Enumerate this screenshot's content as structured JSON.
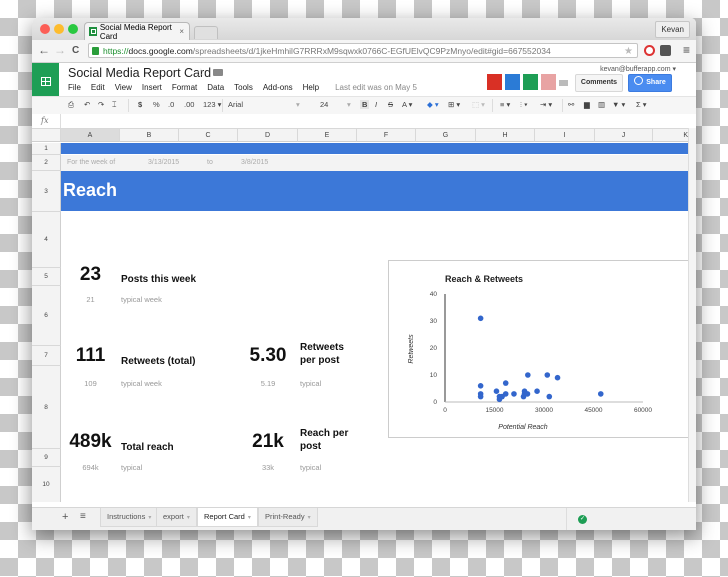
{
  "browser": {
    "tab_title": "Social Media Report Card",
    "tab_close": "×",
    "user_button": "Kevan",
    "url_scheme": "https://",
    "url_host": "docs.google.com",
    "url_path": "/spreadsheets/d/1jkeHmhilG7RRRxM9sqwxk0766C-EGfUElvQC9PzMnyo/edit#gid=667552034",
    "nav_back": "←",
    "nav_forward": "→",
    "nav_reload": "C",
    "bookmark_star": "★",
    "menu_icon": "≡"
  },
  "app": {
    "doc_title": "Social Media Report Card",
    "star": "☆",
    "account": "kevan@bufferapp.com ▾",
    "menu": [
      "File",
      "Edit",
      "View",
      "Insert",
      "Format",
      "Data",
      "Tools",
      "Add-ons",
      "Help"
    ],
    "last_edit": "Last edit was on May 5",
    "comments_label": "Comments",
    "share_label": "Share",
    "addon_colors": [
      "#d93025",
      "#2b7bd6",
      "#1e9e55",
      "#e8a3a3"
    ]
  },
  "toolbar": {
    "print": "⎙",
    "undo": "↶",
    "redo": "↷",
    "paint": "⌶",
    "currency": "$",
    "percent": "%",
    "dec_less": ".0",
    "dec_more": ".00",
    "more_formats": "123 ▾",
    "font": "Arial",
    "font_caret": "▾",
    "size": "24",
    "size_caret": "▾",
    "bold": "B",
    "italic": "I",
    "strike": "S",
    "text_color": "A ▾",
    "fill": "◆ ▾",
    "borders": "⊞ ▾",
    "merge": "⬚ ▾",
    "align": "≡ ▾",
    "valign": "⫶ ▾",
    "wrap": "⇥ ▾",
    "link": "⚯",
    "comment": "▆",
    "chart": "▥",
    "filter": "▼ ▾",
    "functions": "Σ ▾"
  },
  "formula_bar": {
    "fx": "fx",
    "value": ""
  },
  "sheet": {
    "columns": [
      "A",
      "B",
      "C",
      "D",
      "E",
      "F",
      "G",
      "H",
      "I",
      "J",
      "K"
    ],
    "rows": [
      "1",
      "2",
      "3",
      "4",
      "5",
      "6",
      "7",
      "8",
      "9",
      "10"
    ],
    "row2": {
      "label": "For the week of",
      "start": "3/13/2015",
      "to": "to",
      "end": "3/8/2015"
    },
    "section_title": "Reach",
    "metrics": [
      {
        "value": "23",
        "label": "Posts this week",
        "typical_value": "21",
        "typical_label": "typical week"
      },
      {
        "value": "111",
        "label": "Retweets (total)",
        "typical_value": "109",
        "typical_label": "typical week"
      },
      {
        "value": "5.30",
        "label": "Retweets per post",
        "typical_value": "5.19",
        "typical_label": "typical"
      },
      {
        "value": "489k",
        "label": "Total reach",
        "typical_value": "694k",
        "typical_label": "typical"
      },
      {
        "value": "21k",
        "label": "Reach per post",
        "typical_value": "33k",
        "typical_label": "typical"
      }
    ]
  },
  "sheet_tabs": {
    "add": "+",
    "list": "≡",
    "tabs": [
      {
        "label": "Instructions",
        "active": false
      },
      {
        "label": "export",
        "active": false
      },
      {
        "label": "Report Card",
        "active": true
      },
      {
        "label": "Print-Ready",
        "active": false
      }
    ],
    "caret": "▾",
    "saved_icon": "✓"
  },
  "chart_data": {
    "type": "scatter",
    "title": "Reach & Retweets",
    "xlabel": "Potential Reach",
    "ylabel": "Retweets",
    "xlim": [
      0,
      60000
    ],
    "ylim": [
      0,
      40
    ],
    "xticks": [
      0,
      15000,
      30000,
      45000,
      60000
    ],
    "yticks": [
      0,
      10,
      20,
      30,
      40
    ],
    "grid": false,
    "legend": "none",
    "color": "#3366cc",
    "points": [
      [
        10800,
        31
      ],
      [
        10800,
        6
      ],
      [
        10800,
        3
      ],
      [
        10800,
        2
      ],
      [
        15600,
        4
      ],
      [
        18400,
        7
      ],
      [
        18400,
        3
      ],
      [
        16500,
        2
      ],
      [
        16500,
        1
      ],
      [
        17300,
        2
      ],
      [
        20900,
        3
      ],
      [
        25100,
        10
      ],
      [
        24100,
        4
      ],
      [
        24100,
        3
      ],
      [
        23800,
        2
      ],
      [
        25000,
        3
      ],
      [
        27900,
        4
      ],
      [
        31000,
        10
      ],
      [
        31600,
        2
      ],
      [
        34100,
        9
      ],
      [
        47200,
        3
      ]
    ]
  }
}
